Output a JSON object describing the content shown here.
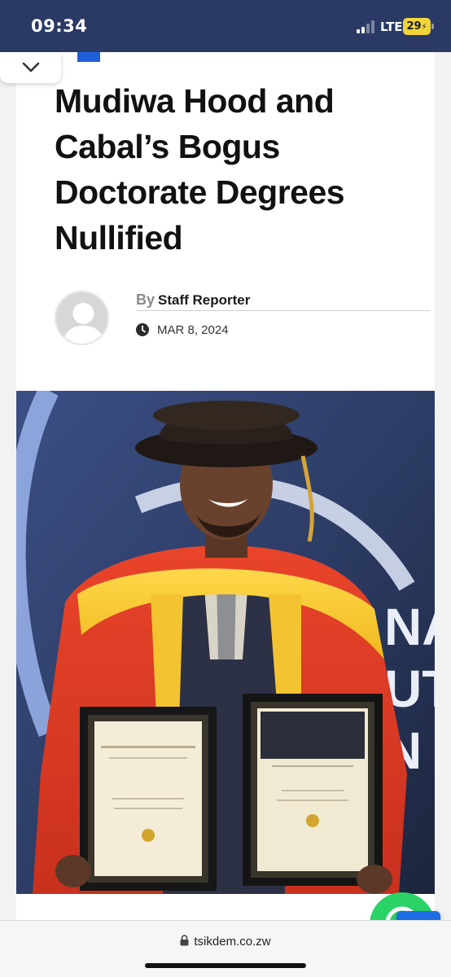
{
  "status_bar": {
    "time": "09:34",
    "network": "LTE",
    "battery": "29"
  },
  "article": {
    "headline": "Mudiwa Hood and Cabal’s Bogus Doctorate Degrees Nullified",
    "by_label": "By",
    "author": "Staff Reporter",
    "date": "MAR 8, 2024"
  },
  "browser": {
    "url": "tsikdem.co.zw"
  },
  "colors": {
    "status_bar": "#2a3a64",
    "accent": "#1e5fd8",
    "whatsapp": "#2bd366",
    "scroll_top": "#1e6ce6"
  },
  "icons": {
    "collapse": "chevron-down-icon",
    "date": "clock-icon",
    "whatsapp": "whatsapp-icon",
    "scroll_top": "chevron-up-icon",
    "lock": "lock-icon"
  }
}
